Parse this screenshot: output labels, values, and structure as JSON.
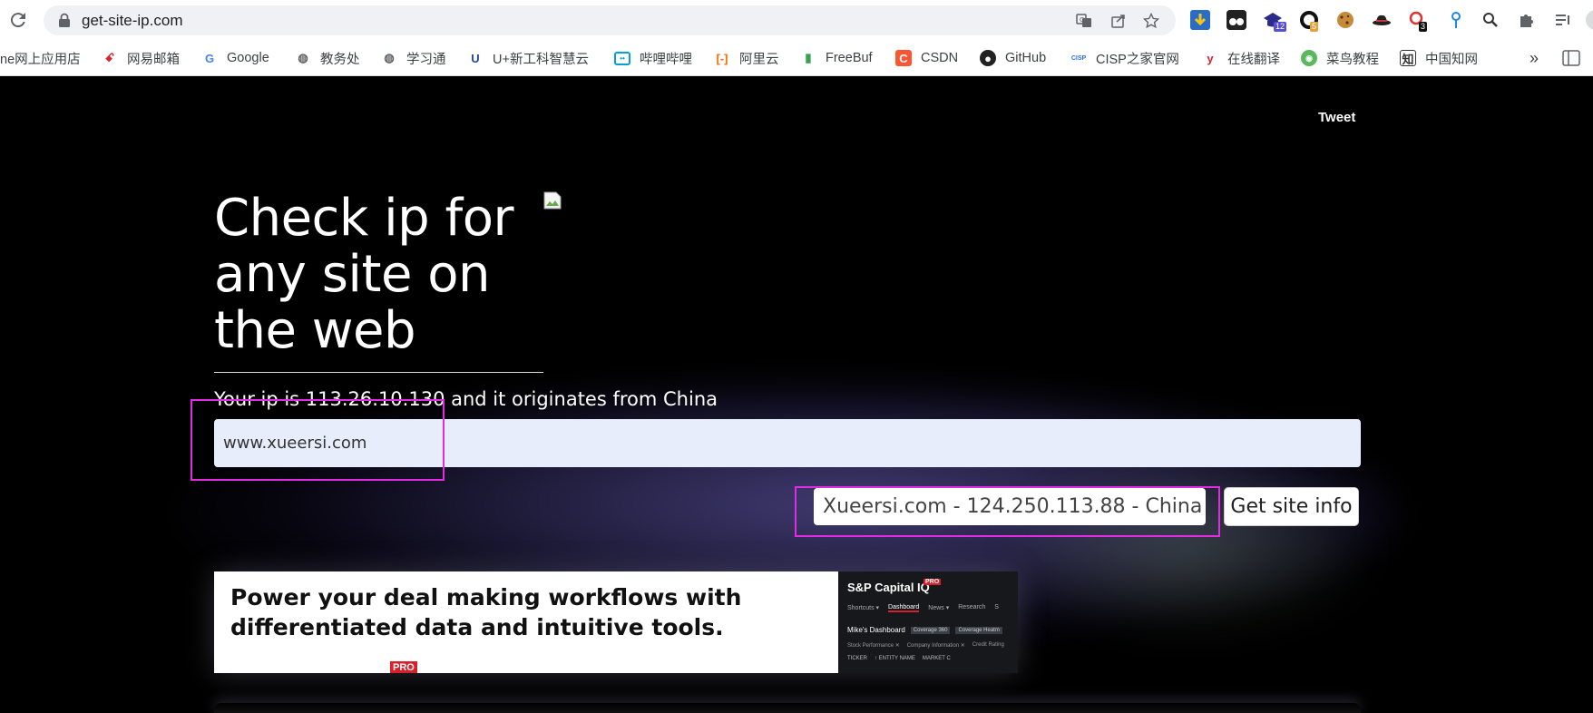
{
  "browser": {
    "url": "get-site-ip.com",
    "extension_badges": {
      "ext3": "12",
      "ext4": "5",
      "ext6": "3"
    },
    "bookmarks": [
      {
        "label": "ne网上应用店",
        "icon": "apps-icon"
      },
      {
        "label": "网易邮箱",
        "icon": "netease-mail-icon"
      },
      {
        "label": "Google",
        "icon": "google-icon"
      },
      {
        "label": "教务处",
        "icon": "globe-icon"
      },
      {
        "label": "学习通",
        "icon": "globe-icon"
      },
      {
        "label": "U+新工科智慧云",
        "icon": "u-plus-icon"
      },
      {
        "label": "哔哩哔哩",
        "icon": "bilibili-icon"
      },
      {
        "label": "阿里云",
        "icon": "aliyun-icon"
      },
      {
        "label": "FreeBuf",
        "icon": "freebuf-icon"
      },
      {
        "label": "CSDN",
        "icon": "csdn-icon"
      },
      {
        "label": "GitHub",
        "icon": "github-icon"
      },
      {
        "label": "CISP之家官网",
        "icon": "cisp-icon"
      },
      {
        "label": "在线翻译",
        "icon": "youdao-icon"
      },
      {
        "label": "菜鸟教程",
        "icon": "runoob-icon"
      },
      {
        "label": "中国知网",
        "icon": "cnki-icon"
      }
    ],
    "overflow_label": "»"
  },
  "page": {
    "tweet_label": "Tweet",
    "title": "Check ip for any site on the web",
    "ip_line": "Your ip is 113.26.10.130 and it originates from China",
    "site_input_value": "www.xueersi.com",
    "result_text": "Xueersi.com - 124.250.113.88 - China",
    "get_button_label": "Get site info"
  },
  "ad": {
    "headline": "Power your deal making workflows with differentiated data and intuitive tools.",
    "pro_badge": "PRO",
    "brand": "S&P Capital IQ",
    "nav": [
      "Shortcuts ▾",
      "Dashboard",
      "News ▾",
      "Research",
      "S"
    ],
    "dashboard_title": "Mike's Dashboard",
    "chips": [
      "Coverage 360",
      "Coverage Heatm"
    ],
    "row_labels": [
      "Stock Performance ✕",
      "Company Information ✕",
      "Credit Rating"
    ],
    "columns": [
      "TICKER",
      "↑ ENTITY NAME",
      "MARKET C"
    ]
  },
  "colors": {
    "highlight": "#e22be2",
    "page_background": "#000000",
    "input_background": "#e8edfb"
  }
}
